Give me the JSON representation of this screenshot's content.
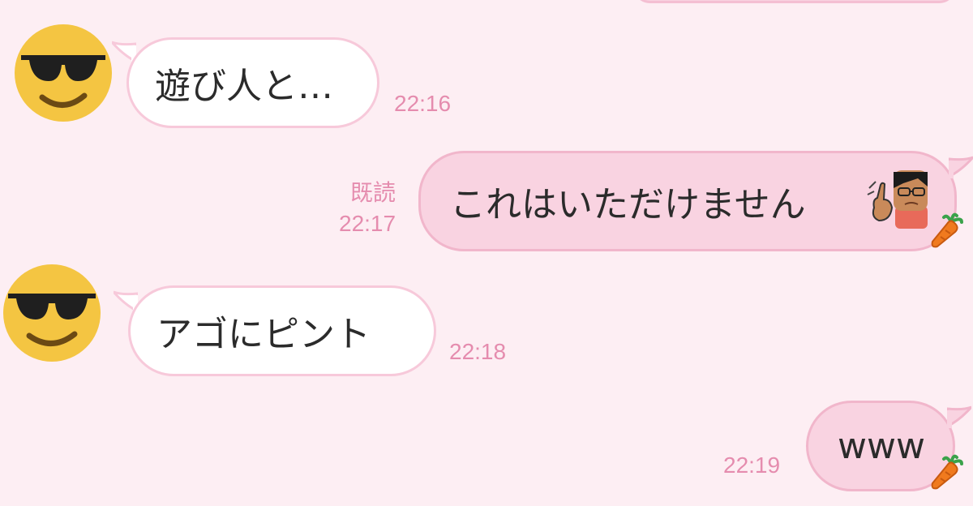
{
  "chat": {
    "messages": [
      {
        "id": "m1",
        "side": "incoming",
        "text": "遊び人と…",
        "time": "22:16"
      },
      {
        "id": "m2",
        "side": "outgoing",
        "text": "これはいただけません",
        "read_label": "既読",
        "time": "22:17",
        "emoji": "shrugging-finger-guy-emoji"
      },
      {
        "id": "m3",
        "side": "incoming",
        "text": "アゴにピント",
        "time": "22:18"
      },
      {
        "id": "m4",
        "side": "outgoing",
        "text": "www",
        "time": "22:19"
      }
    ]
  },
  "colors": {
    "background": "#fdeef3",
    "incoming_bubble": "#ffffff",
    "outgoing_bubble": "#f9d3e1",
    "timestamp": "#e58cae",
    "avatar_face": "#f4c542"
  },
  "icons": {
    "avatar": "sunglasses-smiley-icon",
    "reaction": "carrot-icon"
  }
}
